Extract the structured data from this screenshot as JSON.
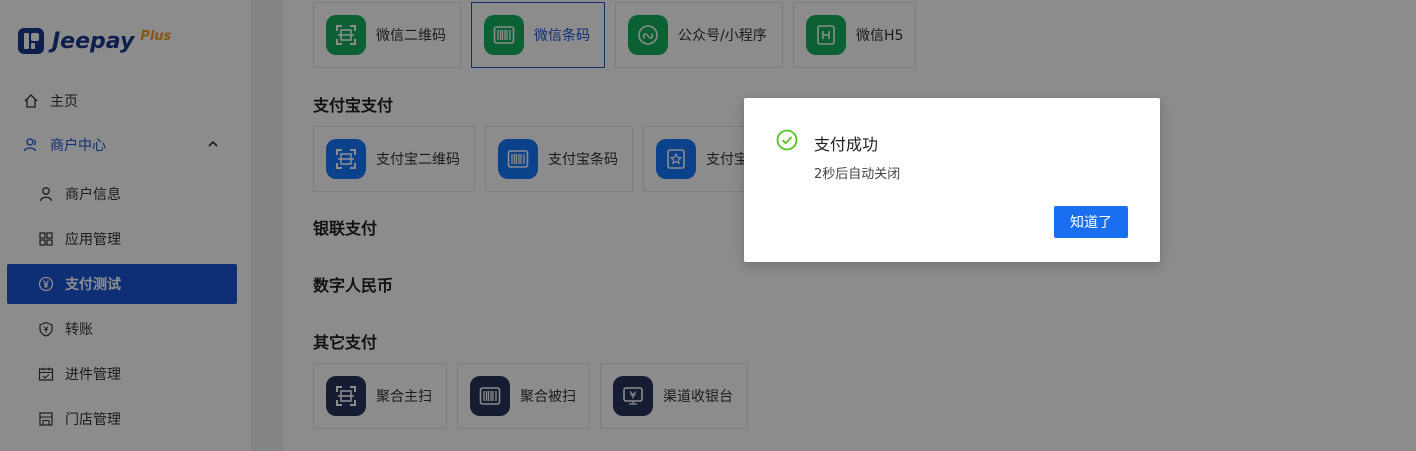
{
  "brand": {
    "name": "Jeepay",
    "suffix": "Plus"
  },
  "sidebar": {
    "items": [
      {
        "label": "主页",
        "icon": "home-icon"
      },
      {
        "label": "商户中心",
        "icon": "user-group-icon",
        "expanded": true
      },
      {
        "label": "商户信息",
        "icon": "user-icon"
      },
      {
        "label": "应用管理",
        "icon": "apps-icon"
      },
      {
        "label": "支付测试",
        "icon": "yen-circle-icon",
        "active": true
      },
      {
        "label": "转账",
        "icon": "yen-shield-icon"
      },
      {
        "label": "进件管理",
        "icon": "calendar-icon"
      },
      {
        "label": "门店管理",
        "icon": "store-icon"
      }
    ]
  },
  "main": {
    "wechat": {
      "items": [
        {
          "label": "微信二维码",
          "icon": "qrcode-scan-icon"
        },
        {
          "label": "微信条码",
          "icon": "barcode-icon",
          "selected": true
        },
        {
          "label": "公众号/小程序",
          "icon": "miniprogram-icon"
        },
        {
          "label": "微信H5",
          "icon": "h5-icon"
        }
      ]
    },
    "alipay": {
      "title": "支付宝支付",
      "items": [
        {
          "label": "支付宝二维码",
          "icon": "qrcode-scan-icon"
        },
        {
          "label": "支付宝条码",
          "icon": "barcode-icon"
        },
        {
          "label": "支付宝",
          "icon": "star-badge-icon"
        }
      ]
    },
    "unionpay": {
      "title": "银联支付"
    },
    "ecny": {
      "title": "数字人民币"
    },
    "other": {
      "title": "其它支付",
      "items": [
        {
          "label": "聚合主扫",
          "icon": "qrcode-scan-icon"
        },
        {
          "label": "聚合被扫",
          "icon": "barcode-icon"
        },
        {
          "label": "渠道收银台",
          "icon": "cashier-icon"
        }
      ]
    }
  },
  "modal": {
    "title": "支付成功",
    "content": "2秒后自动关闭",
    "ok_label": "知道了",
    "icon": "check-circle-icon",
    "accent": "#52c41a"
  },
  "colors": {
    "primary": "#1a57d6",
    "wechat_green": "#15b060",
    "alipay_blue": "#1677ff",
    "other_navy": "#29355e"
  }
}
